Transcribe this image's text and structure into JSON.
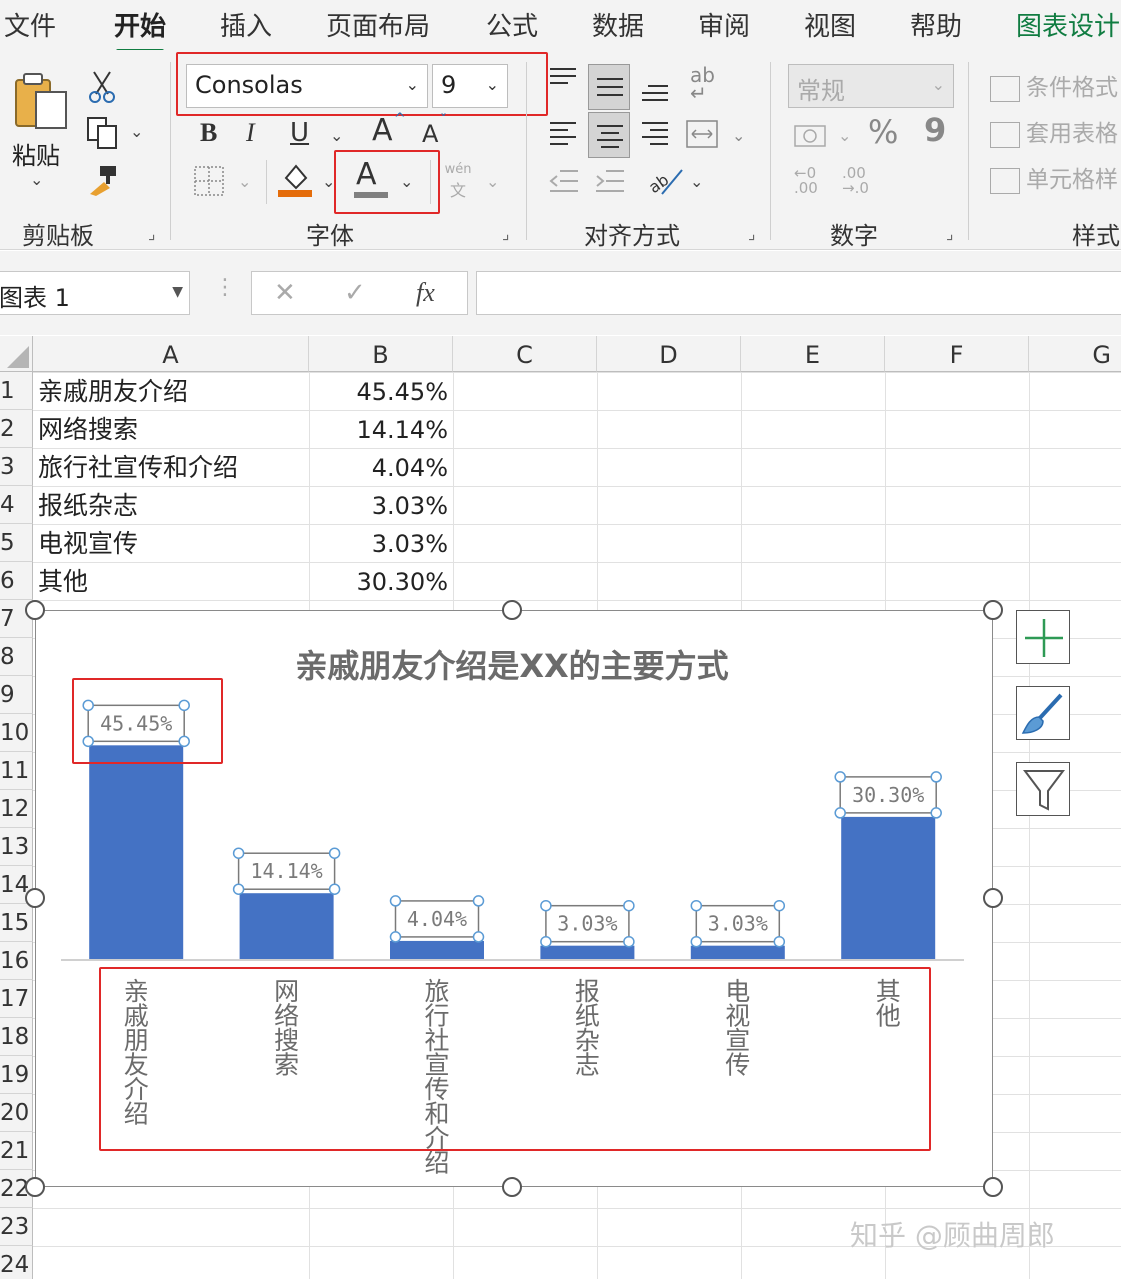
{
  "tabs": [
    "文件",
    "开始",
    "插入",
    "页面布局",
    "公式",
    "数据",
    "审阅",
    "视图",
    "帮助",
    "图表设计"
  ],
  "ribbon": {
    "clipboard": {
      "paste_label": "粘贴",
      "group_label": "剪贴板"
    },
    "font": {
      "font_name": "Consolas",
      "font_size": "9",
      "bold": "B",
      "italic": "I",
      "underline": "U",
      "grow": "A",
      "shrink": "A",
      "font_color_glyph": "A",
      "phonetic_top": "wén",
      "phonetic_bottom": "文",
      "group_label": "字体"
    },
    "alignment": {
      "group_label": "对齐方式",
      "wrap_glyph": "ab"
    },
    "number": {
      "format": "常规",
      "percent": "%",
      "comma": "9",
      "inc_decimal": "←0\n.00",
      "dec_decimal": ".00\n→.0",
      "group_label": "数字"
    },
    "styles": {
      "conditional": "条件格式",
      "table": "套用表格",
      "cell": "单元格样",
      "group_label": "样式"
    }
  },
  "formula_bar": {
    "name_box": "图表 1",
    "cancel": "✕",
    "enter": "✓",
    "fx": "fx",
    "value": ""
  },
  "columns": [
    "A",
    "B",
    "C",
    "D",
    "E",
    "F",
    "G"
  ],
  "rows": [
    "1",
    "2",
    "3",
    "4",
    "5",
    "6",
    "7",
    "8",
    "9",
    "10",
    "11",
    "12",
    "13",
    "14",
    "15",
    "16",
    "17",
    "18",
    "19",
    "20",
    "21",
    "22",
    "23",
    "24"
  ],
  "sheet": [
    {
      "a": "亲戚朋友介绍",
      "b": "45.45%"
    },
    {
      "a": "网络搜索",
      "b": "14.14%"
    },
    {
      "a": "旅行社宣传和介绍",
      "b": "4.04%"
    },
    {
      "a": "报纸杂志",
      "b": "3.03%"
    },
    {
      "a": "电视宣传",
      "b": "3.03%"
    },
    {
      "a": "其他",
      "b": "30.30%"
    }
  ],
  "chart_data": {
    "type": "bar",
    "title": "亲戚朋友介绍是XX的主要方式",
    "categories": [
      "亲戚朋友介绍",
      "网络搜索",
      "旅行社宣传和介绍",
      "报纸杂志",
      "电视宣传",
      "其他"
    ],
    "values": [
      45.45,
      14.14,
      4.04,
      3.03,
      3.03,
      30.3
    ],
    "data_labels": [
      "45.45%",
      "14.14%",
      "4.04%",
      "3.03%",
      "3.03%",
      "30.30%"
    ],
    "ylim": [
      0,
      47
    ],
    "bar_color": "#4472c4",
    "grid": false,
    "legend": "none",
    "category_label_orientation": "vertical-stacked"
  },
  "watermark": "知乎 @顾曲周郎",
  "colors": {
    "accent_green": "#107c41",
    "highlight_red": "#e02828",
    "bar_blue": "#4472c4",
    "selection_handle": "#5b9bd5"
  }
}
